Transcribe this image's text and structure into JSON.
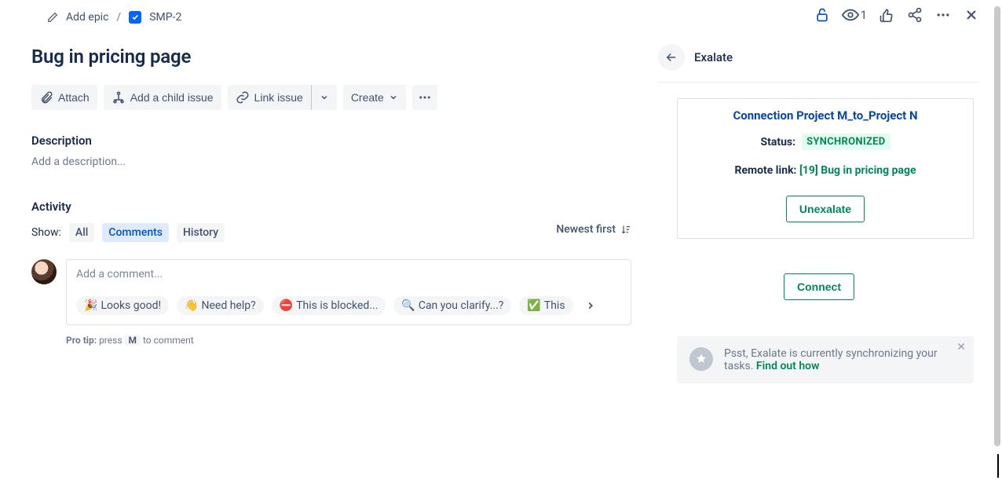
{
  "breadcrumb": {
    "add_epic": "Add epic",
    "issue_key": "SMP-2"
  },
  "top_actions": {
    "watch_count": "1"
  },
  "issue": {
    "title": "Bug in pricing page"
  },
  "actions": {
    "attach": "Attach",
    "add_child": "Add a child issue",
    "link_issue": "Link issue",
    "create": "Create"
  },
  "description": {
    "heading": "Description",
    "placeholder": "Add a description..."
  },
  "activity": {
    "heading": "Activity",
    "show_label": "Show:",
    "tabs": {
      "all": "All",
      "comments": "Comments",
      "history": "History"
    },
    "sort": "Newest first"
  },
  "comment": {
    "placeholder": "Add a comment...",
    "chips": {
      "looks_good": "Looks good!",
      "need_help": "Need help?",
      "blocked": "This is blocked...",
      "clarify": "Can you clarify...?",
      "this": "This"
    },
    "pro_tip_prefix": "Pro tip:",
    "pro_tip_press": "press",
    "pro_tip_key": "M",
    "pro_tip_suffix": "to comment"
  },
  "exalate": {
    "title": "Exalate",
    "connection_name": "Connection Project M_to_Project N",
    "status_label": "Status:",
    "status_value": "SYNCHRONIZED",
    "remote_label": "Remote link:",
    "remote_value": "[19] Bug in pricing page",
    "unexalate_btn": "Unexalate",
    "connect_btn": "Connect",
    "banner_text": "Psst, Exalate is currently synchronizing your tasks.",
    "banner_link": "Find out how"
  }
}
